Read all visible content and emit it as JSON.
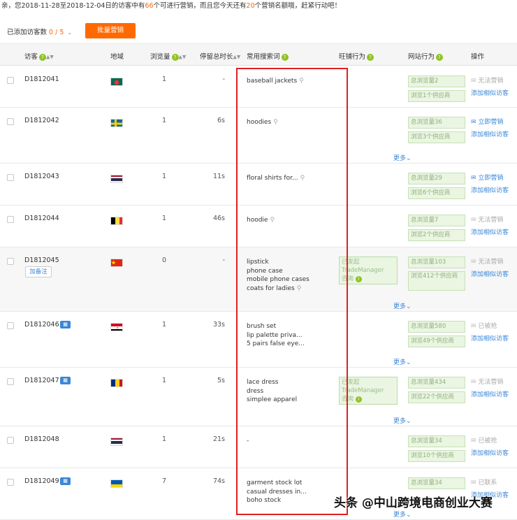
{
  "notice": {
    "prefix": "亲，您2018-11-28至2018-12-04日的访客中有",
    "count": "66",
    "middle": "个可进行营销，而且您今天还有",
    "quota": "20",
    "suffix": "个营销名额哦，赶紧行动吧！"
  },
  "toolbar": {
    "added_label": "已添加访客数",
    "added_count": "0 / 5",
    "bulk_button": "批量营销"
  },
  "columns": {
    "visitor": "访客",
    "region": "地域",
    "views": "浏览量",
    "stay": "停留总时长",
    "keywords": "常用搜索词",
    "tm": "旺铺行为",
    "site": "网站行为",
    "ops": "操作",
    "help": "?"
  },
  "labels": {
    "more": "更多",
    "add_note": "加备注",
    "similar": "添加相似访客",
    "tm_line1": "已发起",
    "tm_line2": "TradeManager",
    "tm_line3": "咨询",
    "info": "i"
  },
  "rows": [
    {
      "id": "D1812041",
      "country": "Bangladesh",
      "views": "1",
      "stay": "-",
      "keywords": [
        "baseball jackets"
      ],
      "total_views": "总浏览量2",
      "suppliers": "浏览1个供应商",
      "op": "无法营销",
      "op_state": "gray"
    },
    {
      "id": "D1812042",
      "country": "Sweden",
      "views": "1",
      "stay": "6s",
      "keywords": [
        "hoodies"
      ],
      "total_views": "总浏览量36",
      "suppliers": "浏览3个供应商",
      "op": "立即营销",
      "op_state": "blue"
    },
    {
      "id": "D1812043",
      "country": "Thailand",
      "views": "1",
      "stay": "11s",
      "keywords": [
        "floral shirts for..."
      ],
      "total_views": "总浏览量29",
      "suppliers": "浏览6个供应商",
      "op": "立即营销",
      "op_state": "blue"
    },
    {
      "id": "D1812044",
      "country": "Belgium",
      "views": "1",
      "stay": "46s",
      "keywords": [
        "hoodie"
      ],
      "total_views": "总浏览量7",
      "suppliers": "浏览2个供应商",
      "op": "无法营销",
      "op_state": "gray"
    },
    {
      "id": "D1812045",
      "country": "China",
      "views": "0",
      "stay": "-",
      "keywords": [
        "lipstick",
        "phone case",
        "mobile phone cases",
        "coats for ladies"
      ],
      "total_views": "总浏览量103",
      "suppliers": "浏览412个供应商",
      "op": "无法营销",
      "op_state": "gray"
    },
    {
      "id": "D1812046",
      "country": "Egypt",
      "views": "1",
      "stay": "33s",
      "keywords": [
        "brush set",
        "lip palette priva...",
        "5 pairs false eye..."
      ],
      "total_views": "总浏览量580",
      "suppliers": "浏览49个供应商",
      "op": "已被抢",
      "op_state": "gray"
    },
    {
      "id": "D1812047",
      "country": "Romania",
      "views": "1",
      "stay": "5s",
      "keywords": [
        "lace dress",
        "dress",
        "simplee apparel"
      ],
      "total_views": "总浏览量434",
      "suppliers": "浏览22个供应商",
      "op": "无法营销",
      "op_state": "gray"
    },
    {
      "id": "D1812048",
      "country": "Thailand",
      "views": "1",
      "stay": "21s",
      "keywords": [
        "-"
      ],
      "total_views": "总浏览量34",
      "suppliers": "浏览10个供应商",
      "op": "已被抢",
      "op_state": "gray"
    },
    {
      "id": "D1812049",
      "country": "Ukraine",
      "views": "7",
      "stay": "74s",
      "keywords": [
        "garment stock lot",
        "casual dresses in...",
        "boho stock"
      ],
      "total_views": "总浏览量34",
      "suppliers": "",
      "op": "已联系",
      "op_state": "gray"
    }
  ],
  "watermark": "头条 @中山跨境电商创业大赛",
  "colors": {
    "accent": "#ff6a00",
    "link": "#3a86d6",
    "highlight_box": "#e02020",
    "stat_bg": "#eaf5e2"
  }
}
